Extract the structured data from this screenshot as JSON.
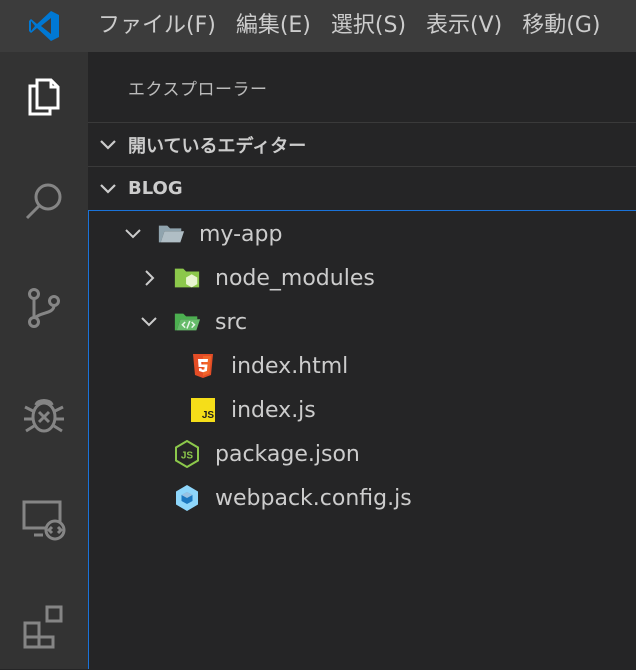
{
  "menubar": {
    "items": [
      "ファイル(F)",
      "編集(E)",
      "選択(S)",
      "表示(V)",
      "移動(G)"
    ]
  },
  "activitybar": {
    "items": [
      "explorer-icon",
      "search-icon",
      "source-control-icon",
      "debug-icon",
      "remote-explorer-icon",
      "extensions-icon"
    ]
  },
  "sidebar": {
    "title": "エクスプローラー",
    "open_editors_label": "開いているエディター",
    "workspace_label": "BLOG"
  },
  "tree": {
    "items": [
      {
        "label": "my-app",
        "icon": "folder-open-icon",
        "expanded": true
      },
      {
        "label": "node_modules",
        "icon": "node-folder-icon",
        "expanded": false
      },
      {
        "label": "src",
        "icon": "src-folder-icon",
        "expanded": true
      },
      {
        "label": "index.html",
        "icon": "html5-icon"
      },
      {
        "label": "index.js",
        "icon": "javascript-icon"
      },
      {
        "label": "package.json",
        "icon": "nodejs-icon"
      },
      {
        "label": "webpack.config.js",
        "icon": "webpack-icon"
      }
    ]
  },
  "colors": {
    "menubar_bg": "#3c3c3c",
    "activitybar_bg": "#333333",
    "sidebar_bg": "#252526",
    "focus_border": "#1a73d9",
    "vscode_blue": "#0078d4",
    "html_orange": "#e44d26",
    "js_yellow": "#f5de19",
    "node_green": "#8cc84b",
    "webpack_blue": "#8ed6fb"
  }
}
